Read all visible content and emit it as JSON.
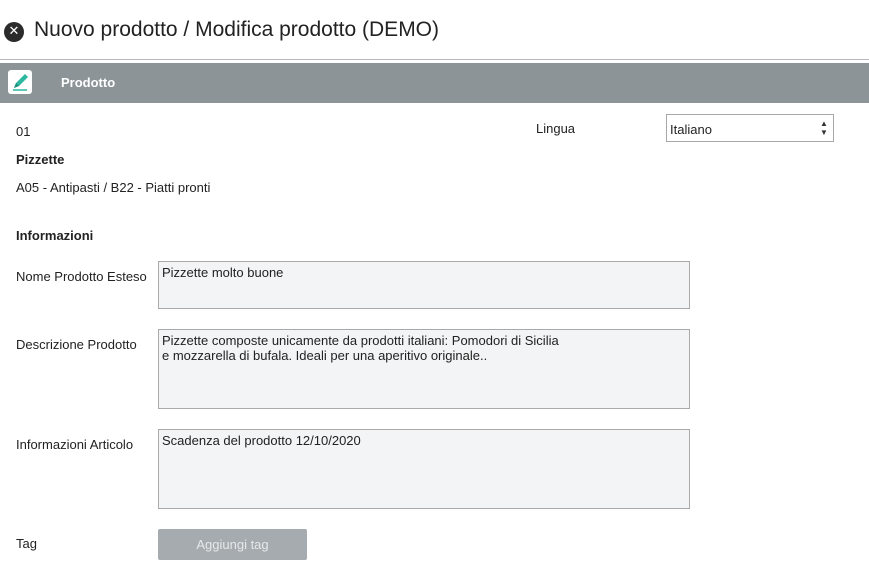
{
  "window": {
    "title": "Nuovo prodotto / Modifica prodotto (DEMO)"
  },
  "section": {
    "label": "Prodotto",
    "icon": "pencil-icon"
  },
  "product": {
    "code": "01",
    "name": "Pizzette",
    "category_path": "A05 - Antipasti / B22 - Piatti pronti"
  },
  "language": {
    "label": "Lingua",
    "selected": "Italiano"
  },
  "info": {
    "heading": "Informazioni",
    "fields": [
      {
        "label": "Nome Prodotto Esteso",
        "value": "Pizzette molto buone"
      },
      {
        "label": "Descrizione Prodotto",
        "value": "Pizzette composte unicamente da prodotti italiani: Pomodori di Sicilia\ne mozzarella di bufala. Ideali per una aperitivo originale.."
      },
      {
        "label": "Informazioni Articolo",
        "value": "Scadenza del prodotto 12/10/2020"
      }
    ]
  },
  "tag": {
    "label": "Tag",
    "button_label": "Aggiungi tag"
  },
  "colors": {
    "header_bar": "#8d9498",
    "pencil": "#2bb7a0",
    "button": "#a6abaf"
  }
}
